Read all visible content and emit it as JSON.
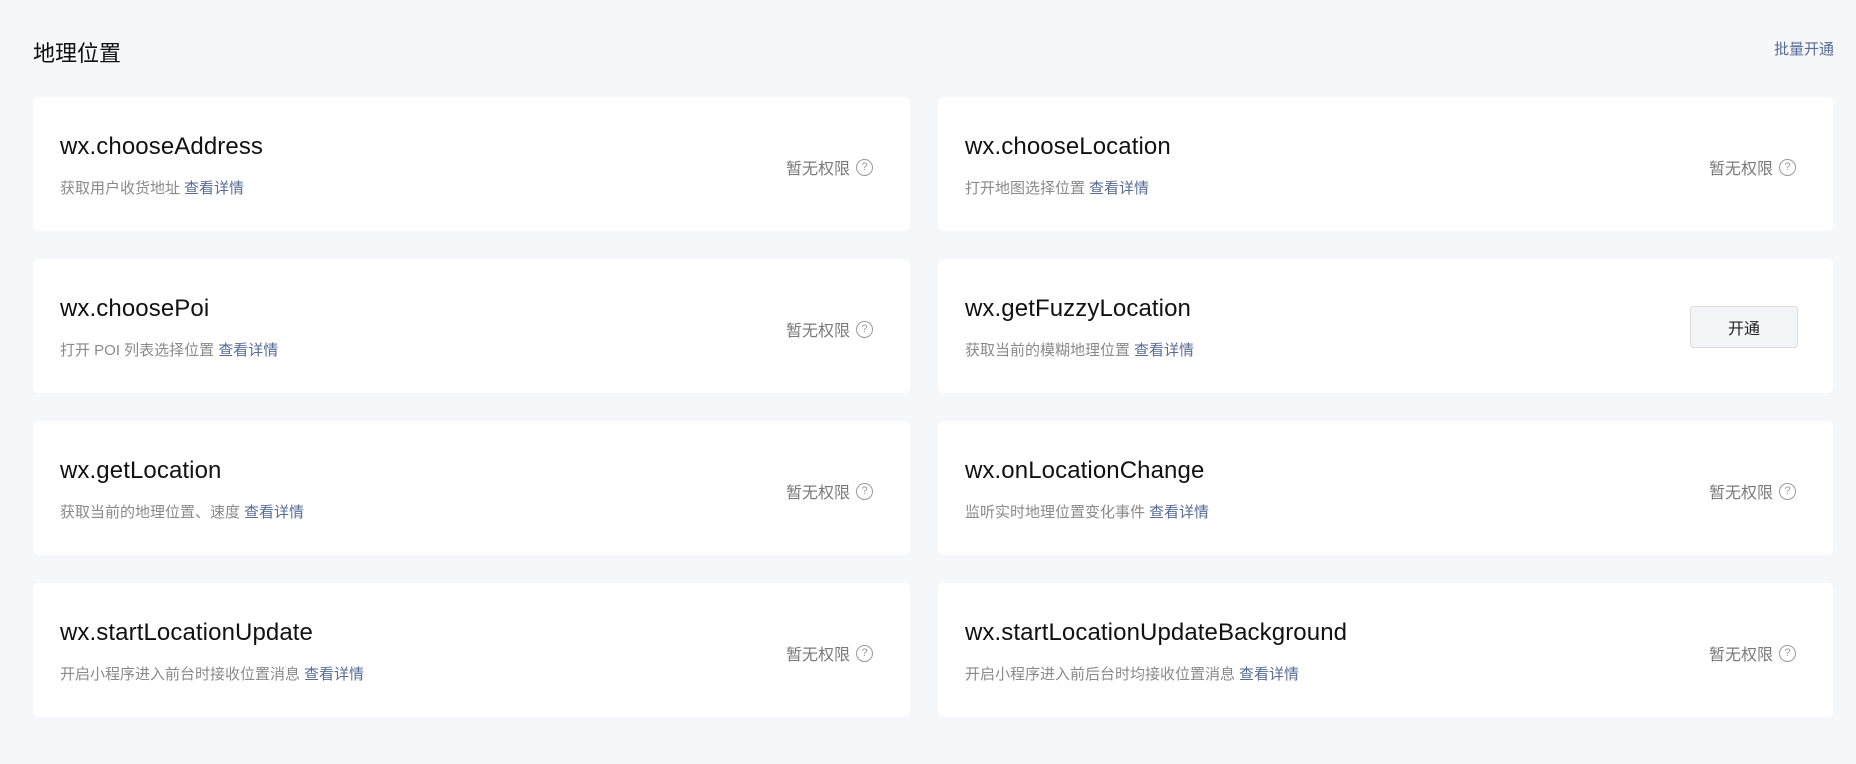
{
  "header": {
    "title": "地理位置",
    "batch_label": "批量开通"
  },
  "common": {
    "detail_label": "查看详情",
    "no_permission_label": "暂无权限",
    "help_glyph": "?"
  },
  "apis": [
    {
      "name": "wx.chooseAddress",
      "desc": "获取用户收货地址",
      "status": "no_permission"
    },
    {
      "name": "wx.chooseLocation",
      "desc": "打开地图选择位置",
      "status": "no_permission"
    },
    {
      "name": "wx.choosePoi",
      "desc": "打开 POI 列表选择位置",
      "status": "no_permission"
    },
    {
      "name": "wx.getFuzzyLocation",
      "desc": "获取当前的模糊地理位置",
      "status": "open",
      "button_label": "开通"
    },
    {
      "name": "wx.getLocation",
      "desc": "获取当前的地理位置、速度",
      "status": "no_permission"
    },
    {
      "name": "wx.onLocationChange",
      "desc": "监听实时地理位置变化事件",
      "status": "no_permission"
    },
    {
      "name": "wx.startLocationUpdate",
      "desc": "开启小程序进入前台时接收位置消息",
      "status": "no_permission"
    },
    {
      "name": "wx.startLocationUpdateBackground",
      "desc": "开启小程序进入前后台时均接收位置消息",
      "status": "no_permission"
    }
  ],
  "colors": {
    "link": "#576b95",
    "background": "#f6f7f9",
    "card": "#ffffff"
  },
  "icons": {
    "help": "question-circle-icon"
  }
}
